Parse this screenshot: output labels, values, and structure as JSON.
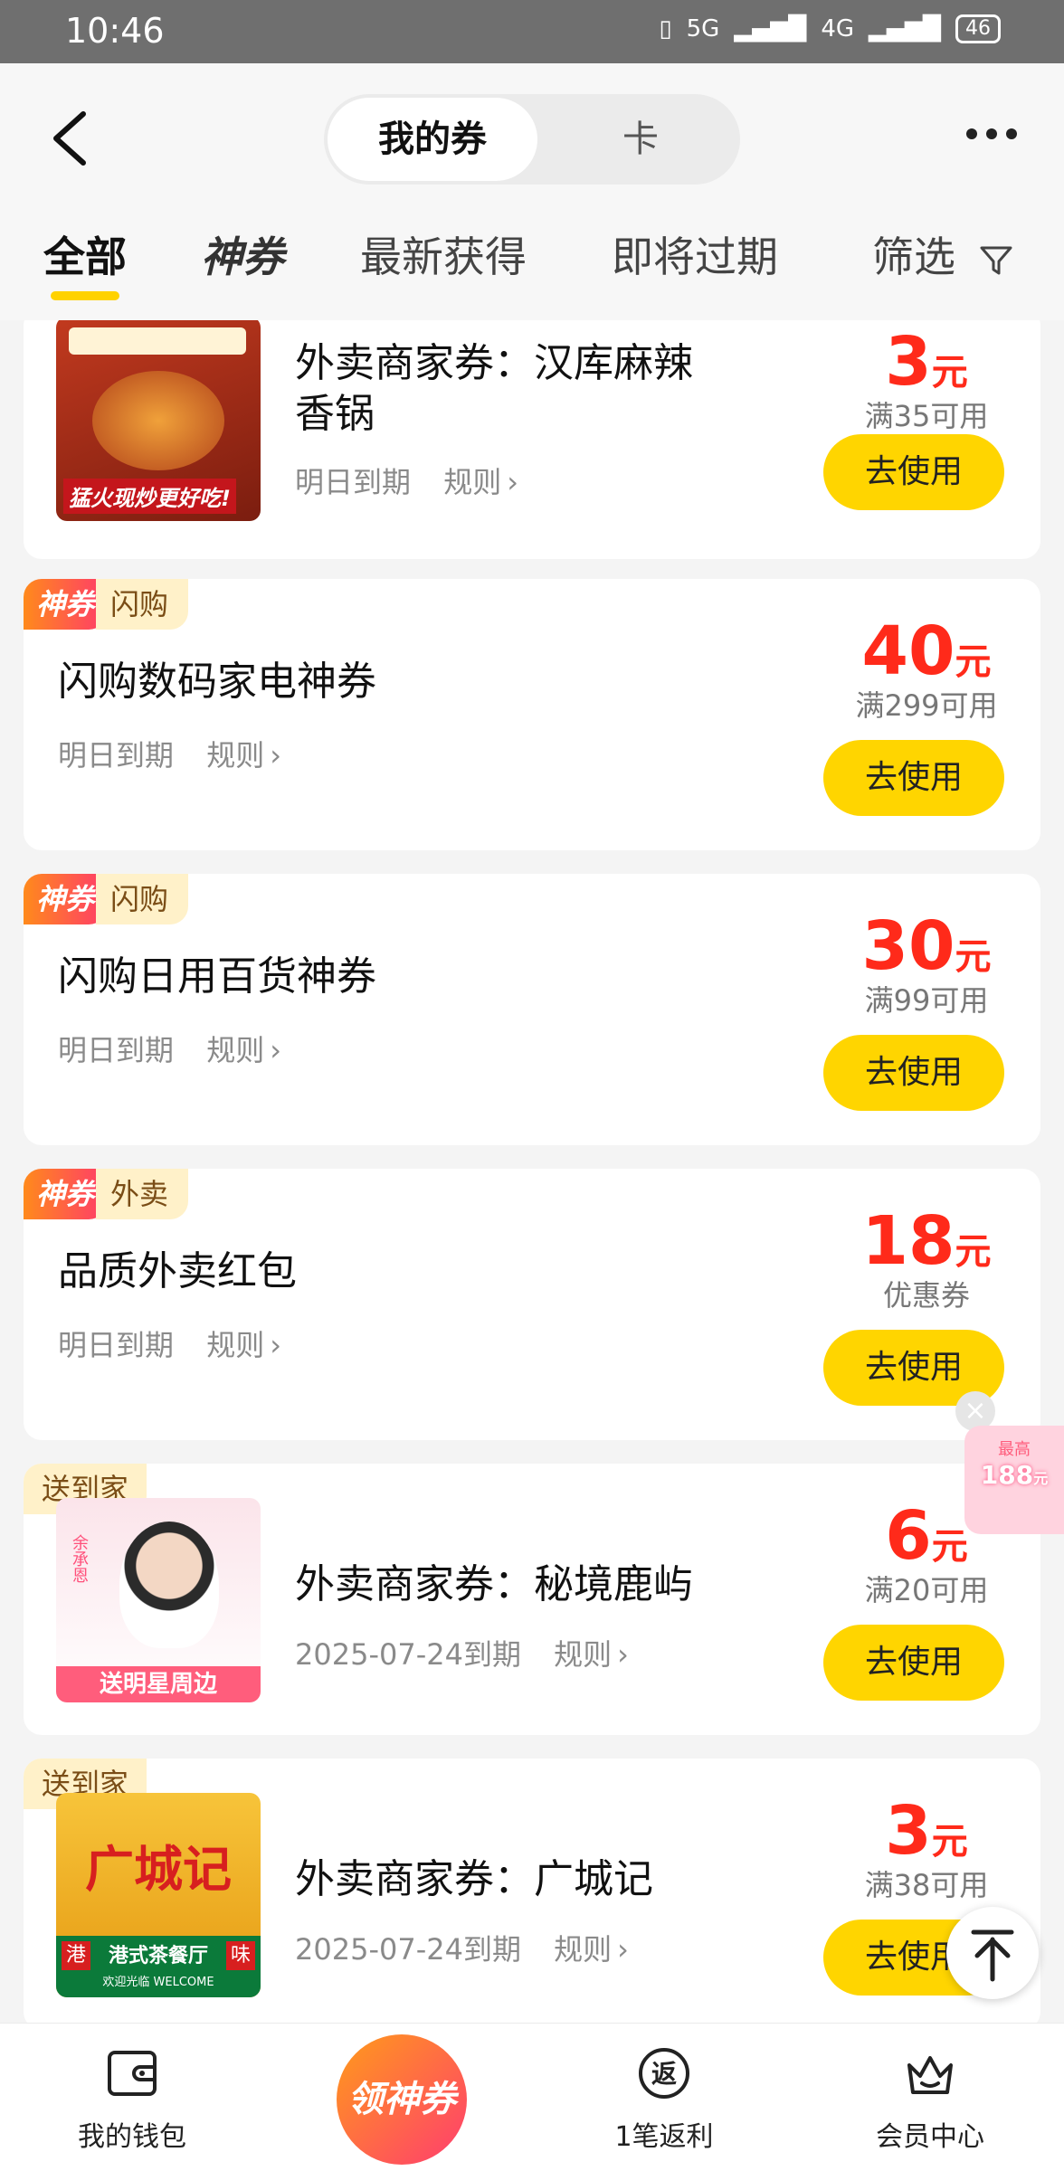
{
  "status_bar": {
    "time": "10:46",
    "signal1": "5G",
    "signal2": "4G",
    "battery": "46"
  },
  "header": {
    "tabs": [
      "我的券",
      "卡"
    ],
    "filter_tabs": [
      "全部",
      "神券",
      "最新获得",
      "即将过期",
      "筛选"
    ]
  },
  "coupons": [
    {
      "title_line1": "外卖商家券：汉库麻辣",
      "title_line2": "香锅",
      "expiry": "明日到期",
      "rule": "规则",
      "amount": "3",
      "unit": "元",
      "condition": "满35可用",
      "button": "去使用",
      "thumb_text": "猛火现炒更好吃!"
    },
    {
      "badge": "神券",
      "category": "闪购",
      "title": "闪购数码家电神券",
      "expiry": "明日到期",
      "rule": "规则",
      "amount": "40",
      "unit": "元",
      "condition": "满299可用",
      "button": "去使用"
    },
    {
      "badge": "神券",
      "category": "闪购",
      "title": "闪购日用百货神券",
      "expiry": "明日到期",
      "rule": "规则",
      "amount": "30",
      "unit": "元",
      "condition": "满99可用",
      "button": "去使用"
    },
    {
      "badge": "神券",
      "category": "外卖",
      "title": "品质外卖红包",
      "expiry": "明日到期",
      "rule": "规则",
      "amount": "18",
      "unit": "元",
      "condition": "优惠券",
      "button": "去使用"
    },
    {
      "delivery_badge": "送到家",
      "title": "外卖商家券：秘境鹿屿",
      "expiry": "2025-07-24到期",
      "rule": "规则",
      "amount": "6",
      "unit": "元",
      "condition": "满20可用",
      "button": "去使用",
      "thumb_text": "送明星周边",
      "thumb_name": "余承恩"
    },
    {
      "delivery_badge": "送到家",
      "title": "外卖商家券：广城记",
      "expiry": "2025-07-24到期",
      "rule": "规则",
      "amount": "3",
      "unit": "元",
      "condition": "满38可用",
      "button": "去使用",
      "thumb_title": "广城记",
      "thumb_sub": "港式茶餐厅",
      "thumb_welcome": "欢迎光临 WELCOME",
      "thumb_left": "港",
      "thumb_right": "味"
    }
  ],
  "floating_ad": {
    "label": "最高",
    "value": "188",
    "unit": "元"
  },
  "bottom_nav": {
    "wallet": "我的钱包",
    "center": "领神券",
    "rebate": "1笔返利",
    "rebate_icon": "返",
    "member": "会员中心"
  }
}
